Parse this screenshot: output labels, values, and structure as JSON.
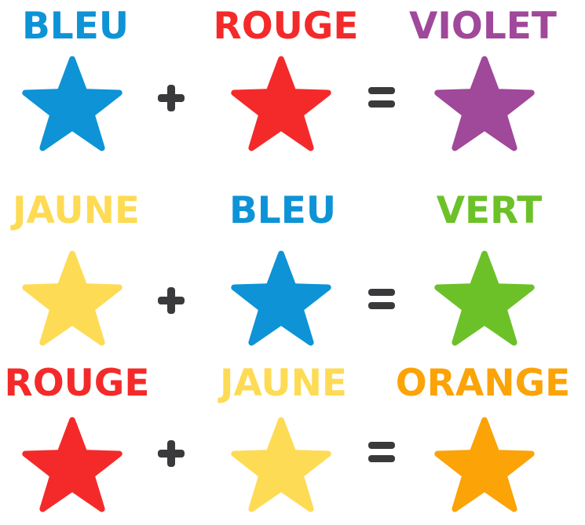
{
  "colors": {
    "blue": "#0d93d6",
    "red": "#f42a2a",
    "violet": "#a0489a",
    "yellow": "#fedb55",
    "green": "#6cc128",
    "orange": "#fba307",
    "operator": "#3a3a3c"
  },
  "rows": [
    {
      "left": {
        "label": "BLEU",
        "color_key": "blue"
      },
      "middle": {
        "label": "ROUGE",
        "color_key": "red"
      },
      "result": {
        "label": "VIOLET",
        "color_key": "violet"
      }
    },
    {
      "left": {
        "label": "JAUNE",
        "color_key": "yellow"
      },
      "middle": {
        "label": "BLEU",
        "color_key": "blue"
      },
      "result": {
        "label": "VERT",
        "color_key": "green"
      }
    },
    {
      "left": {
        "label": "ROUGE",
        "color_key": "red"
      },
      "middle": {
        "label": "JAUNE",
        "color_key": "yellow"
      },
      "result": {
        "label": "ORANGE",
        "color_key": "orange"
      }
    }
  ],
  "operators": {
    "plus": "plus-icon",
    "equals": "equals-icon"
  },
  "icons": {
    "star": "star-icon"
  }
}
